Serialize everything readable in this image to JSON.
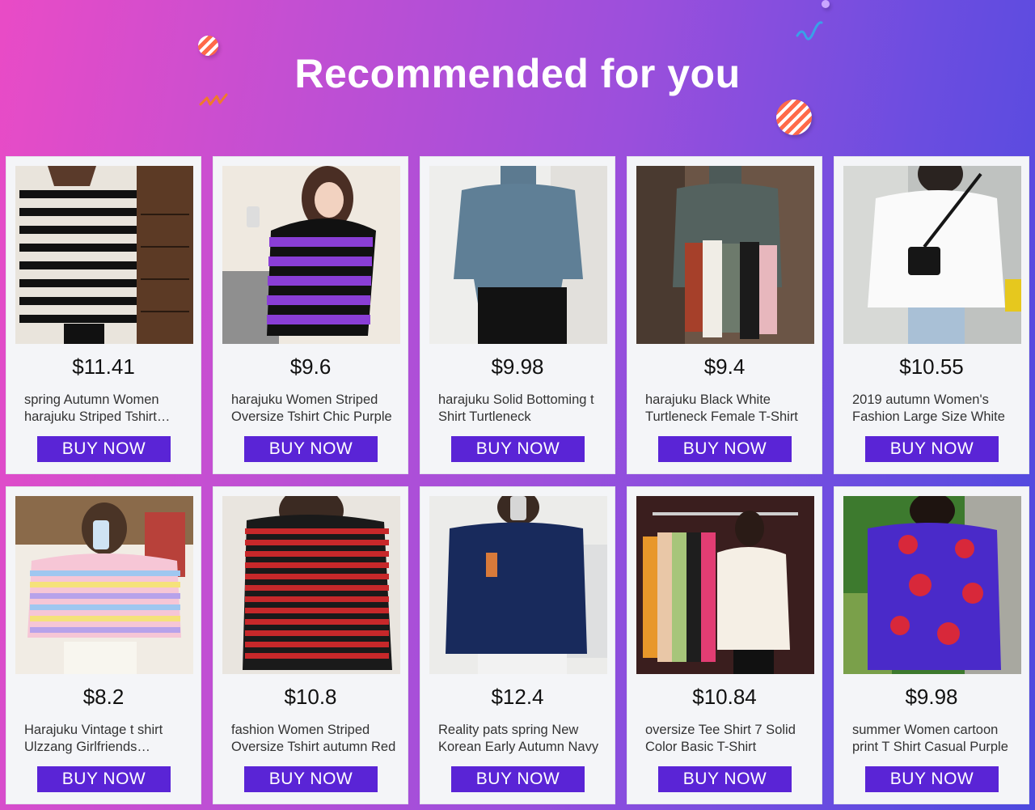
{
  "header": {
    "title": "Recommended for you"
  },
  "products": [
    {
      "price": "$11.41",
      "description": "spring Autumn Women harajuku Striped Tshirt Long Sleeve",
      "button": "BUY NOW",
      "image_icon": "black-white-striped-shirt-photo"
    },
    {
      "price": "$9.6",
      "description": "harajuku Women Striped Oversize Tshirt Chic Purple",
      "button": "BUY NOW",
      "image_icon": "purple-striped-shirt-photo"
    },
    {
      "price": "$9.98",
      "description": "harajuku Solid Bottoming t Shirt Turtleneck",
      "button": "BUY NOW",
      "image_icon": "blue-turtleneck-photo"
    },
    {
      "price": "$9.4",
      "description": "harajuku Black White Turtleneck Female T-Shirt",
      "button": "BUY NOW",
      "image_icon": "gray-turtleneck-photo"
    },
    {
      "price": "$10.55",
      "description": "2019 autumn Women's Fashion Large Size White",
      "button": "BUY NOW",
      "image_icon": "white-longsleeve-photo"
    },
    {
      "price": "$8.2",
      "description": "Harajuku Vintage t shirt Ulzzang Girlfriends Rainbow",
      "button": "BUY NOW",
      "image_icon": "rainbow-striped-shirt-photo"
    },
    {
      "price": "$10.8",
      "description": "fashion Women Striped Oversize Tshirt autumn Red",
      "button": "BUY NOW",
      "image_icon": "red-striped-shirt-photo"
    },
    {
      "price": "$12.4",
      "description": "Reality pats spring New Korean Early Autumn Navy",
      "button": "BUY NOW",
      "image_icon": "navy-longsleeve-photo"
    },
    {
      "price": "$10.84",
      "description": "oversize Tee Shirt 7 Solid Color Basic T-Shirt",
      "button": "BUY NOW",
      "image_icon": "white-oversize-tee-photo"
    },
    {
      "price": "$9.98",
      "description": "summer Women cartoon print T Shirt Casual Purple",
      "button": "BUY NOW",
      "image_icon": "purple-cartoon-tee-photo"
    }
  ],
  "colors": {
    "button": "#5a24d6",
    "card_bg": "#f4f5f8",
    "gradient_left": "#e94bc6",
    "gradient_right": "#4c49df"
  }
}
